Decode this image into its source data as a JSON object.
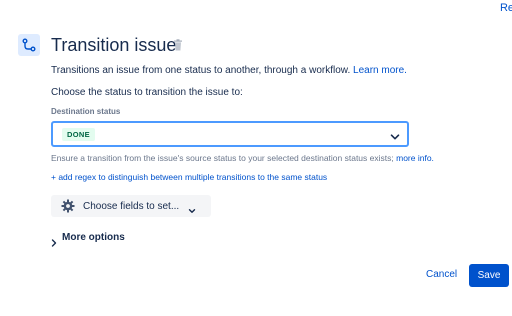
{
  "corner_link": "Re",
  "header": {
    "icon": "transition-icon",
    "title": "Transition issue",
    "delete_icon": "trash-icon"
  },
  "description": {
    "text": "Transitions an issue from one status to another, through a workflow. ",
    "link": "Learn more."
  },
  "prompt": "Choose the status to transition the issue to:",
  "destination": {
    "label": "Destination status",
    "selected": "DONE",
    "selected_color": "#006644",
    "selected_bg": "#E3FCEF"
  },
  "helper": {
    "text": "Ensure a transition from the issue's source status to your selected destination status exists; ",
    "link": "more info."
  },
  "regex_link": "+ add regex to distinguish between multiple transitions to the same status",
  "fields_button": {
    "icon": "gear-icon",
    "label": "Choose fields to set..."
  },
  "more_options": "More options",
  "actions": {
    "cancel": "Cancel",
    "save": "Save"
  },
  "colors": {
    "primary": "#0052CC",
    "focus_border": "#4C9AFF",
    "text": "#172B4D",
    "subtle_text": "#6B778C"
  }
}
